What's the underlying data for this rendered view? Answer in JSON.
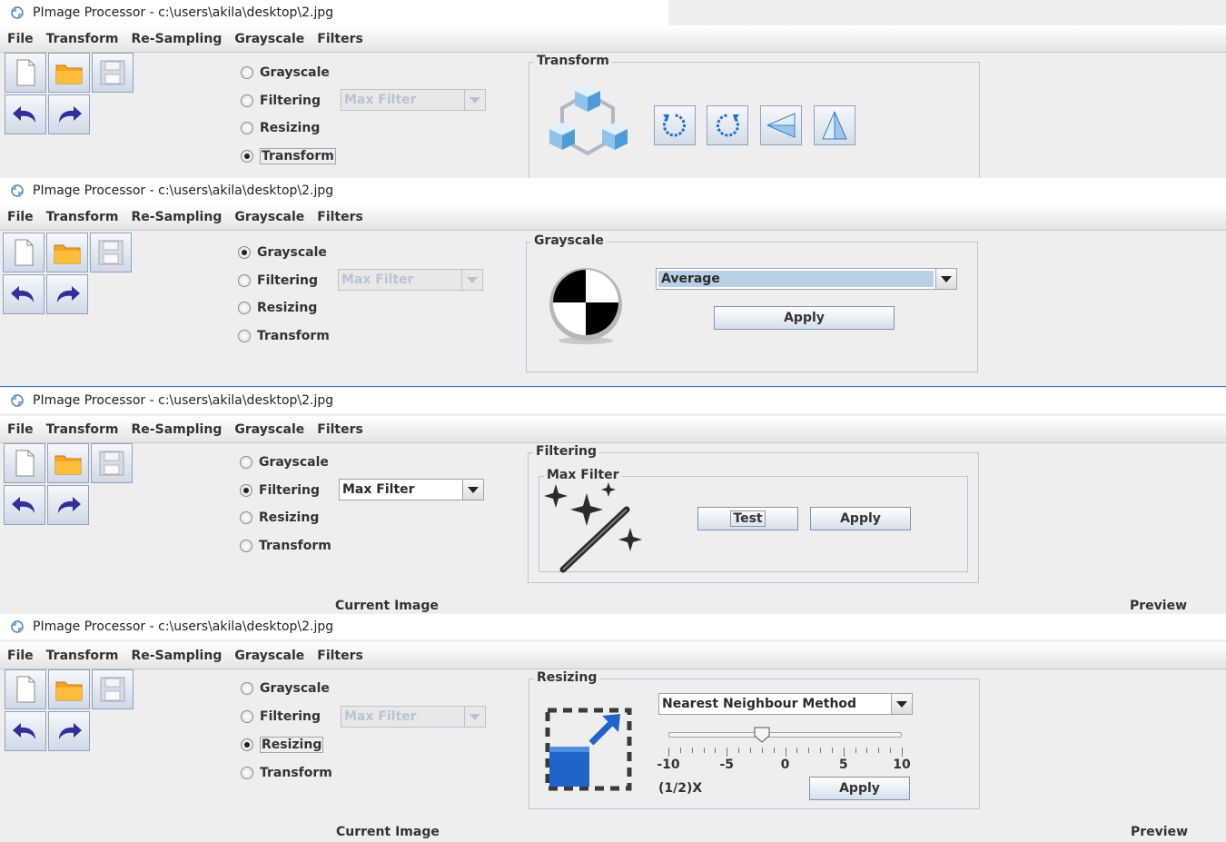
{
  "app": {
    "title": "PImage Processor - c:\\users\\akila\\desktop\\2.jpg"
  },
  "menu": [
    "File",
    "Transform",
    "Re-Sampling",
    "Grayscale",
    "Filters"
  ],
  "radios": [
    "Grayscale",
    "Filtering",
    "Resizing",
    "Transform"
  ],
  "filter_combo": {
    "disabled_value": "Max Filter",
    "value": "Max Filter"
  },
  "panel1": {
    "group_title": "Transform",
    "buttons": [
      "rotate-left-icon",
      "rotate-right-icon",
      "flip-horizontal-icon",
      "flip-vertical-icon"
    ]
  },
  "panel2": {
    "group_title": "Grayscale",
    "method": "Average",
    "apply": "Apply"
  },
  "panel3": {
    "group_title": "Filtering",
    "inner_title": "Max Filter",
    "test": "Test",
    "apply": "Apply"
  },
  "panel4": {
    "group_title": "Resizing",
    "method": "Nearest Neighbour Method",
    "slider": {
      "min": -10,
      "max": 10,
      "value": -2,
      "major_ticks": [
        -10,
        -5,
        0,
        5,
        10
      ]
    },
    "scale_label": "(1/2)X",
    "apply": "Apply"
  },
  "captions": {
    "current": "Current Image",
    "preview": "Preview"
  },
  "colors": {
    "accent": "#1e6fd1",
    "titlebar": "#ffffff",
    "background": "#eeeeee"
  }
}
